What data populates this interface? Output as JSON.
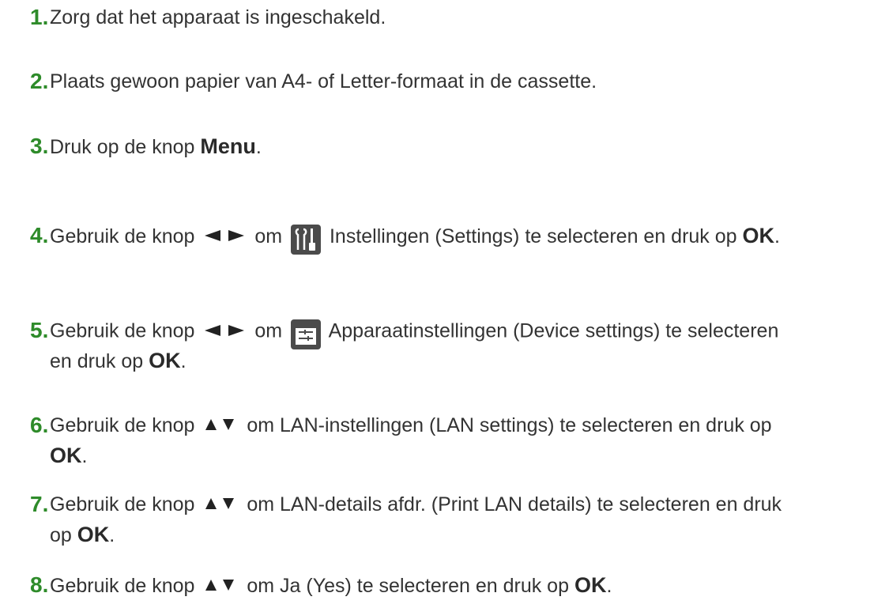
{
  "steps": [
    {
      "number": "1.",
      "text": "Zorg dat het apparaat is ingeschakeld."
    },
    {
      "number": "2.",
      "text": "Plaats gewoon papier van A4- of Letter-formaat in de cassette."
    },
    {
      "number": "3.",
      "text_before": "Druk op de knop ",
      "bold": "Menu",
      "text_after": "."
    },
    {
      "number": "4.",
      "text_before": "Gebruik de knop ",
      "icon": "left-right-arrows-icon",
      "text_middle_1": " om ",
      "menu_icon": "settings-tools-icon",
      "text_middle_2": " Instellingen (Settings) te selecteren en druk op ",
      "bold": "OK",
      "text_after": "."
    },
    {
      "number": "5.",
      "text_before": "Gebruik de knop ",
      "icon": "left-right-arrows-icon",
      "text_middle_1": " om ",
      "menu_icon": "device-settings-icon",
      "text_middle_2": " Apparaatinstellingen (Device settings) te selecteren",
      "line2_before": "en druk op ",
      "bold": "OK",
      "text_after": "."
    },
    {
      "number": "6.",
      "text_before": "Gebruik de knop ",
      "icon": "up-down-arrows-icon",
      "text_middle": " om LAN-instellingen (LAN settings) te selecteren en druk op",
      "bold": "OK",
      "text_after": "."
    },
    {
      "number": "7.",
      "text_before": "Gebruik de knop ",
      "icon": "up-down-arrows-icon",
      "text_middle": " om LAN-details afdr. (Print LAN details) te selecteren en druk",
      "line2_before": "op ",
      "bold": "OK",
      "text_after": "."
    },
    {
      "number": "8.",
      "text_before": "Gebruik de knop ",
      "icon": "up-down-arrows-icon",
      "text_middle": " om Ja (Yes) te selecteren en druk op ",
      "bold": "OK",
      "text_after": "."
    }
  ],
  "colors": {
    "step_number": "#2e8b2a",
    "text": "#333333",
    "icon_bg": "#4b4b4b"
  }
}
